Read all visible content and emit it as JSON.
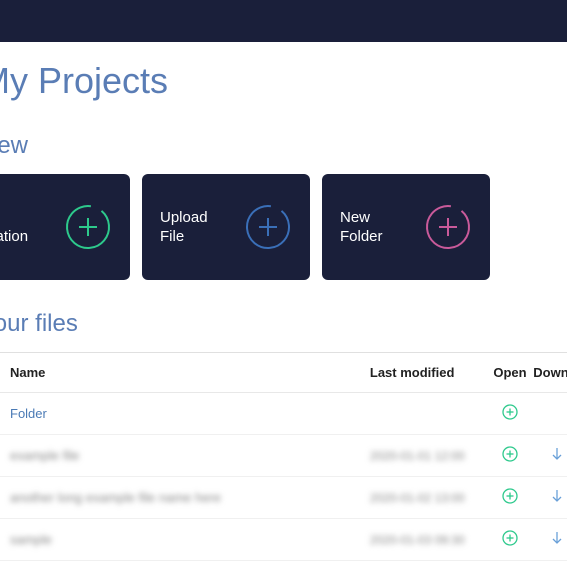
{
  "page_title": "My Projects",
  "section_new": "New",
  "cards": {
    "sim": {
      "label": "New\nSimulation",
      "color": "#2dc98c"
    },
    "upload": {
      "label": "Upload\nFile",
      "color": "#3a6fb8"
    },
    "folder": {
      "label": "New\nFolder",
      "color": "#c95a9a"
    }
  },
  "section_files": "Your files",
  "table": {
    "headers": {
      "name": "Name",
      "modified": "Last modified",
      "open": "Open",
      "download": "Down"
    },
    "rows": [
      {
        "name": "Folder",
        "modified": "",
        "has_download": false,
        "blurred": false
      },
      {
        "name": "example file",
        "modified": "2020-01-01 12:00",
        "has_download": true,
        "blurred": true
      },
      {
        "name": "another long example file name here",
        "modified": "2020-01-02 13:00",
        "has_download": true,
        "blurred": true
      },
      {
        "name": "sample",
        "modified": "2020-01-03 09:30",
        "has_download": true,
        "blurred": true
      }
    ]
  },
  "colors": {
    "brand_bg": "#1a1f3a",
    "heading": "#5a7db5",
    "link": "#4a7ab5",
    "open_icon": "#2dc98c",
    "download_icon": "#6aa0d8"
  }
}
